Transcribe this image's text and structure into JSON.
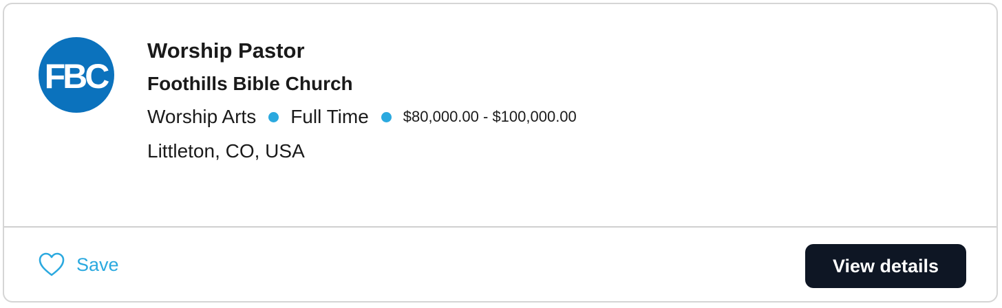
{
  "job": {
    "title": "Worship Pastor",
    "organization": "Foothills Bible Church",
    "logo_text": "FBC",
    "logo_color": "#0b72bd",
    "category": "Worship Arts",
    "employment_type": "Full Time",
    "salary": "$80,000.00 - $100,000.00",
    "location": "Littleton, CO, USA"
  },
  "actions": {
    "save_label": "Save",
    "save_icon": "heart-outline-icon",
    "view_details_label": "View details"
  },
  "colors": {
    "accent": "#2ba9df",
    "button_bg": "#0e1624",
    "text": "#1a1a1a",
    "border": "#d5d5d5"
  }
}
